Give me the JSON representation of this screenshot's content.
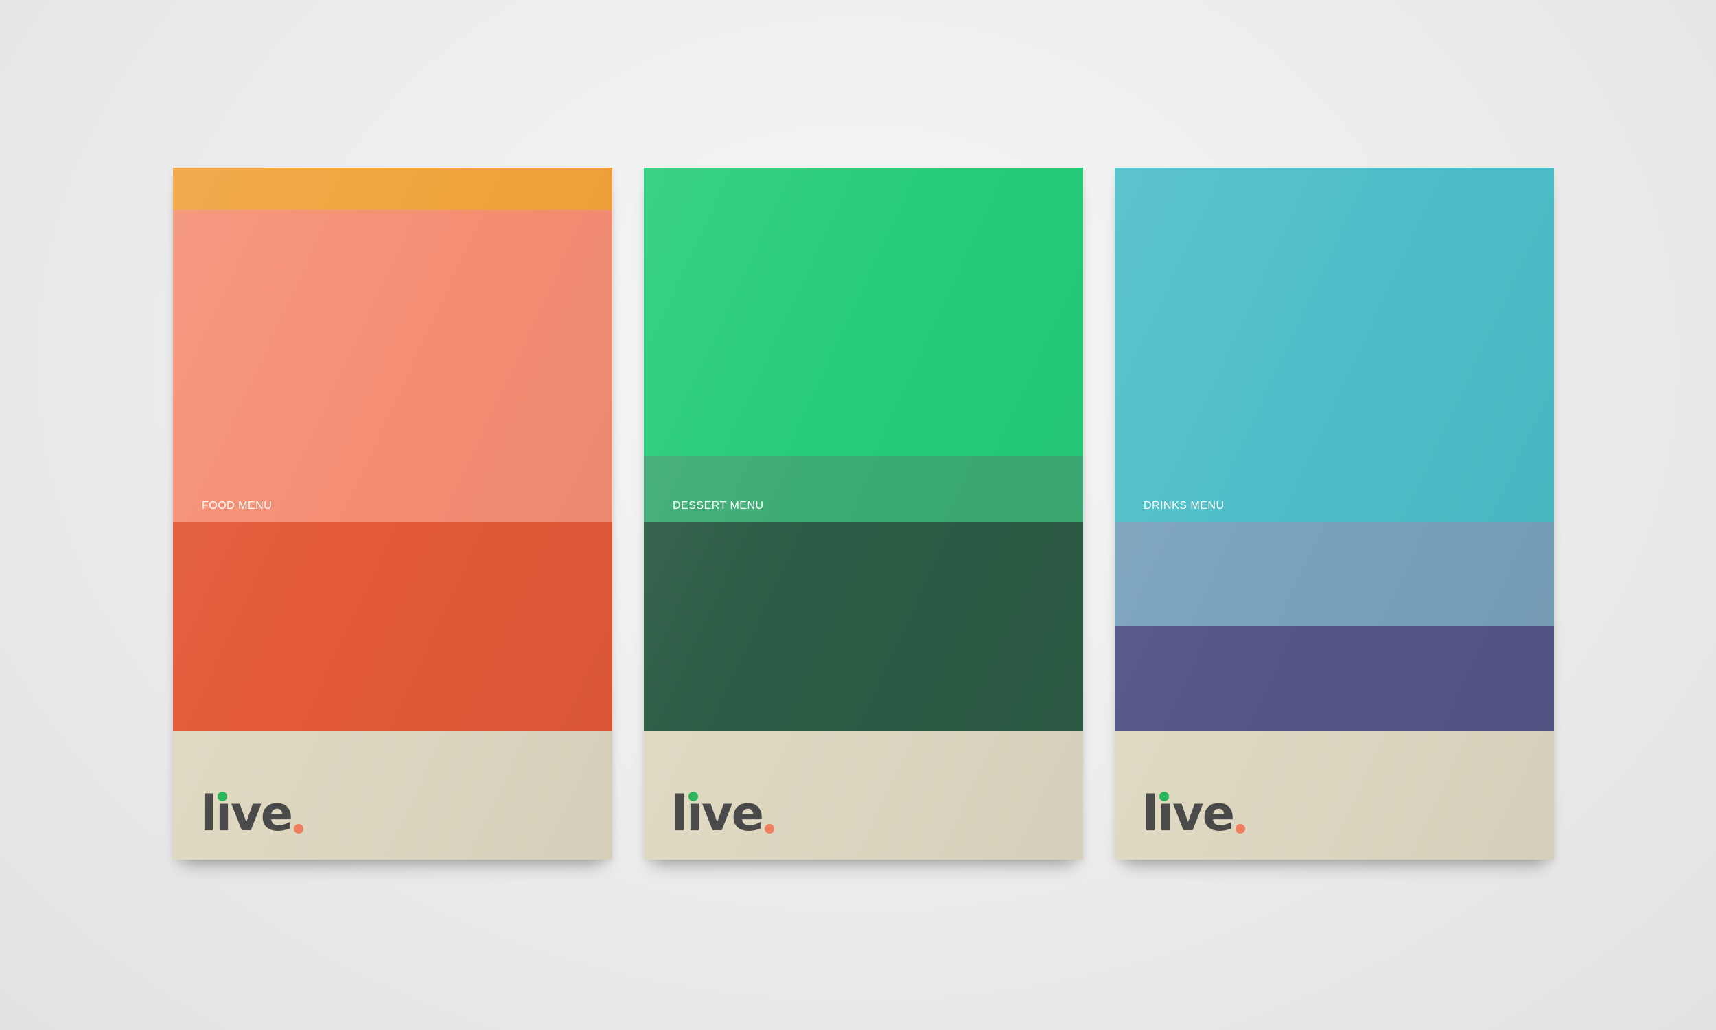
{
  "colors": {
    "cream": "#e0d9c2",
    "logo_text": "#4a4a4a",
    "logo_dot_green": "#2bb55a",
    "logo_dot_orange": "#f0815f"
  },
  "cards": [
    {
      "label": "FOOD MENU",
      "bands": [
        "#f0a23a",
        "#f48e73",
        "#e35a37",
        "#e0d9c2"
      ]
    },
    {
      "label": "DESSERT MENU",
      "bands": [
        "#24cc77",
        "#3cab74",
        "#2c5c45",
        "#e0d9c2"
      ]
    },
    {
      "label": "DRINKS MENU",
      "bands": [
        "#4cbdc7",
        "#7aa2bd",
        "#555687",
        "#e0d9c2"
      ]
    }
  ],
  "logo": {
    "text": "live"
  }
}
